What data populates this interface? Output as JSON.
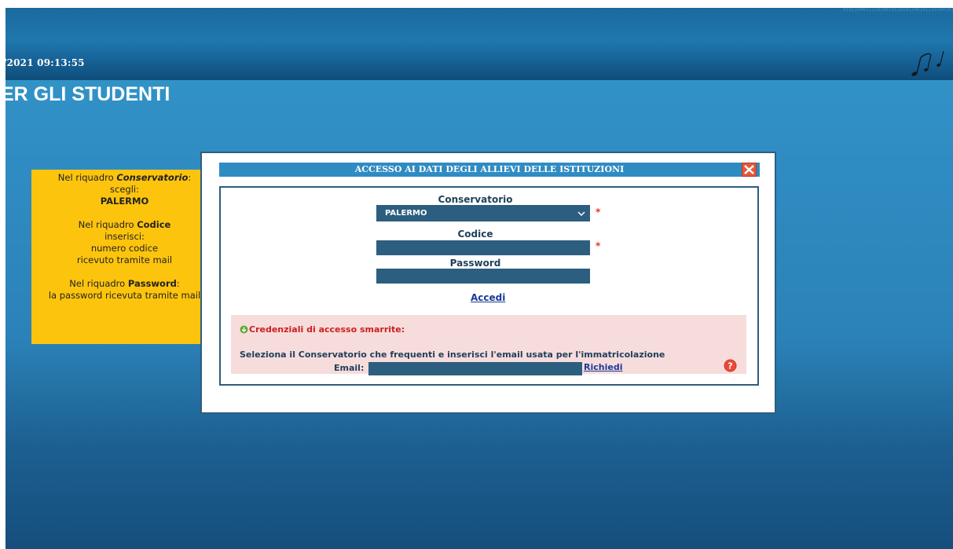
{
  "header": {
    "datetime": "/2021 09:13:55",
    "page_title": "ER GLI STUDENTI"
  },
  "help_note": {
    "line1_prefix": "Nel riquadro ",
    "line1_emph": "Conservatorio",
    "line1_suffix": ":",
    "line2": "scegli:",
    "line3": "PALERMO",
    "line4_prefix": "Nel riquadro ",
    "line4_emph": "Codice",
    "line5": "inserisci:",
    "line6": "numero codice",
    "line7": "ricevuto tramite mail",
    "line8_prefix": "Nel riquadro ",
    "line8_emph": "Password",
    "line8_suffix": ":",
    "line9": "la password ricevuta tramite mail"
  },
  "dialog": {
    "title": "ACCESSO AI DATI DEGLI ALLIEVI DELLE ISTITUZIONI",
    "conservatorio_label": "Conservatorio",
    "conservatorio_value": "PALERMO",
    "codice_label": "Codice",
    "codice_value": "",
    "password_label": "Password",
    "password_value": "",
    "required_mark": "*",
    "login_link": "Accedi",
    "recovery": {
      "title": "Credenziali di accesso smarrite:",
      "instructions": "Seleziona il Conservatorio che frequenti e inserisci l'email usata per l'immatricolazione",
      "email_label": "Email:",
      "email_value": "",
      "request_link": "Richiedi"
    }
  },
  "colors": {
    "background": "#2f8cc2",
    "topbar": "#1a6a9d",
    "note_yellow": "#fdc40e",
    "input_fill": "#2c5e80",
    "recovery_bg": "#f7dcdc",
    "required": "#e0361f",
    "link": "#1a3a98"
  },
  "icons": {
    "close": "close-icon",
    "dropdown": "chevron-down-icon",
    "recovery": "arrow-down-circle-icon",
    "help": "question-mark-icon",
    "logo": "music-notes-icon"
  }
}
